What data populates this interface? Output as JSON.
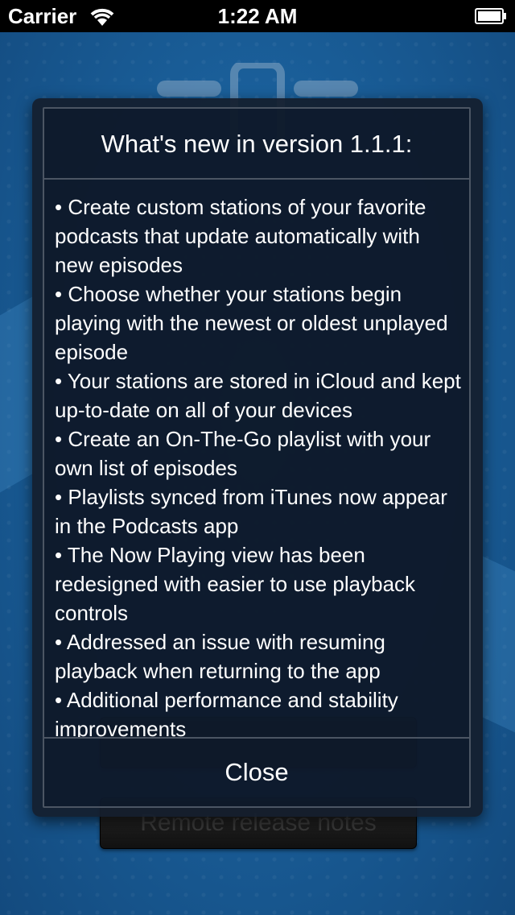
{
  "status_bar": {
    "carrier": "Carrier",
    "time": "1:22 AM",
    "wifi_icon": "wifi-icon",
    "battery_icon": "battery-icon"
  },
  "background": {
    "button_remote_notes": "Remote release notes"
  },
  "dialog": {
    "title": "What's new in version 1.1.1:",
    "notes": [
      "• Create custom stations of your favorite podcasts that update automatically with new episodes",
      "• Choose whether your stations begin playing with the newest or oldest unplayed episode",
      "• Your stations are stored in iCloud and kept up-to-date on all of your devices",
      "• Create an On-The-Go playlist with your own list of episodes",
      "• Playlists synced from iTunes now appear in the Podcasts app",
      "• The Now Playing view has been redesigned with easier to use playback controls",
      "• Addressed an issue with resuming playback when returning to the app",
      "• Additional performance and stability improvements"
    ],
    "close_label": "Close"
  },
  "colors": {
    "background_blue": "#1a5f9a",
    "dialog_bg": "#141e2d",
    "dialog_border": "#4b5563",
    "text": "#ffffff"
  }
}
